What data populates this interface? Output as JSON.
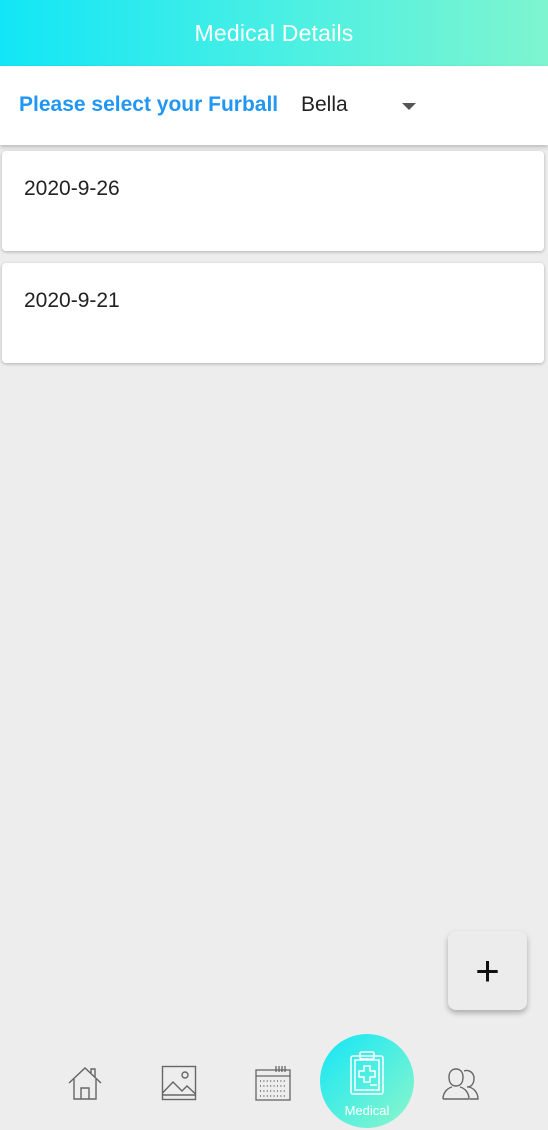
{
  "app_bar": {
    "title": "Medical Details",
    "gradient": [
      "#12e6f6",
      "#7ef5cf"
    ]
  },
  "selector": {
    "label": "Please select your Furball",
    "selected": "Bella",
    "label_color": "#2196f3"
  },
  "records": [
    {
      "date": "2020-9-26"
    },
    {
      "date": "2020-9-21"
    }
  ],
  "fab": {
    "symbol": "+"
  },
  "bottom_nav": {
    "items": [
      {
        "name": "home",
        "icon": "home-icon"
      },
      {
        "name": "gallery",
        "icon": "image-icon"
      },
      {
        "name": "calendar",
        "icon": "calendar-icon"
      },
      {
        "name": "medical",
        "icon": "medical-clipboard-icon",
        "label": "Medical",
        "active": true
      },
      {
        "name": "profile",
        "icon": "users-icon"
      }
    ]
  }
}
